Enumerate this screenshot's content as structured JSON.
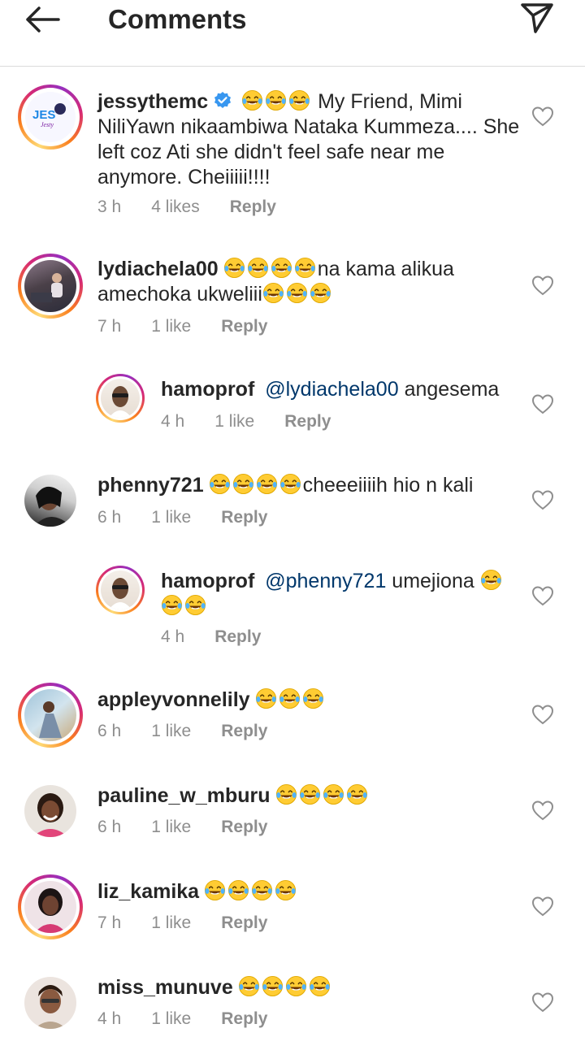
{
  "header": {
    "title": "Comments",
    "back_icon": "back-arrow-icon",
    "share_icon": "paper-plane-icon"
  },
  "colors": {
    "ring_start": "#feda75",
    "ring_mid": "#d62976",
    "mention": "#00376b",
    "verified": "#3897f0",
    "meta": "#8e8e8e"
  },
  "comments": [
    {
      "username": "jessythemc",
      "verified": true,
      "emoji_before": 3,
      "text": "My Friend, Mimi NiliYawn nikaambiwa Nataka Kummeza.... She left coz Ati she didn't feel safe near me anymore. Cheiiiii!!!!",
      "time": "3 h",
      "likes": "4 likes",
      "reply": "Reply",
      "avatar_text": "JES"
    },
    {
      "username": "lydiachela00",
      "emoji_before": 4,
      "text": "na kama alikua amechoka ukweliii",
      "emoji_after": 3,
      "time": "7 h",
      "likes": "1 like",
      "reply": "Reply"
    },
    {
      "username": "hamoprof",
      "mention": "@lydiachela00",
      "text": "angesema",
      "time": "4 h",
      "likes": "1 like",
      "reply": "Reply"
    },
    {
      "username": "phenny721",
      "emoji_before": 4,
      "text": "cheeeiiiih hio n kali",
      "time": "6 h",
      "likes": "1 like",
      "reply": "Reply"
    },
    {
      "username": "hamoprof",
      "mention": "@phenny721",
      "text": "umejiona",
      "time": "4 h",
      "reply": "Reply"
    },
    {
      "username": "appleyvonnelily",
      "time": "6 h",
      "likes": "1 like",
      "reply": "Reply"
    },
    {
      "username": "pauline_w_mburu",
      "time": "6 h",
      "likes": "1 like",
      "reply": "Reply"
    },
    {
      "username": "liz_kamika",
      "time": "7 h",
      "likes": "1 like",
      "reply": "Reply"
    },
    {
      "username": "miss_munuve",
      "time": "4 h",
      "likes": "1 like",
      "reply": "Reply"
    }
  ]
}
